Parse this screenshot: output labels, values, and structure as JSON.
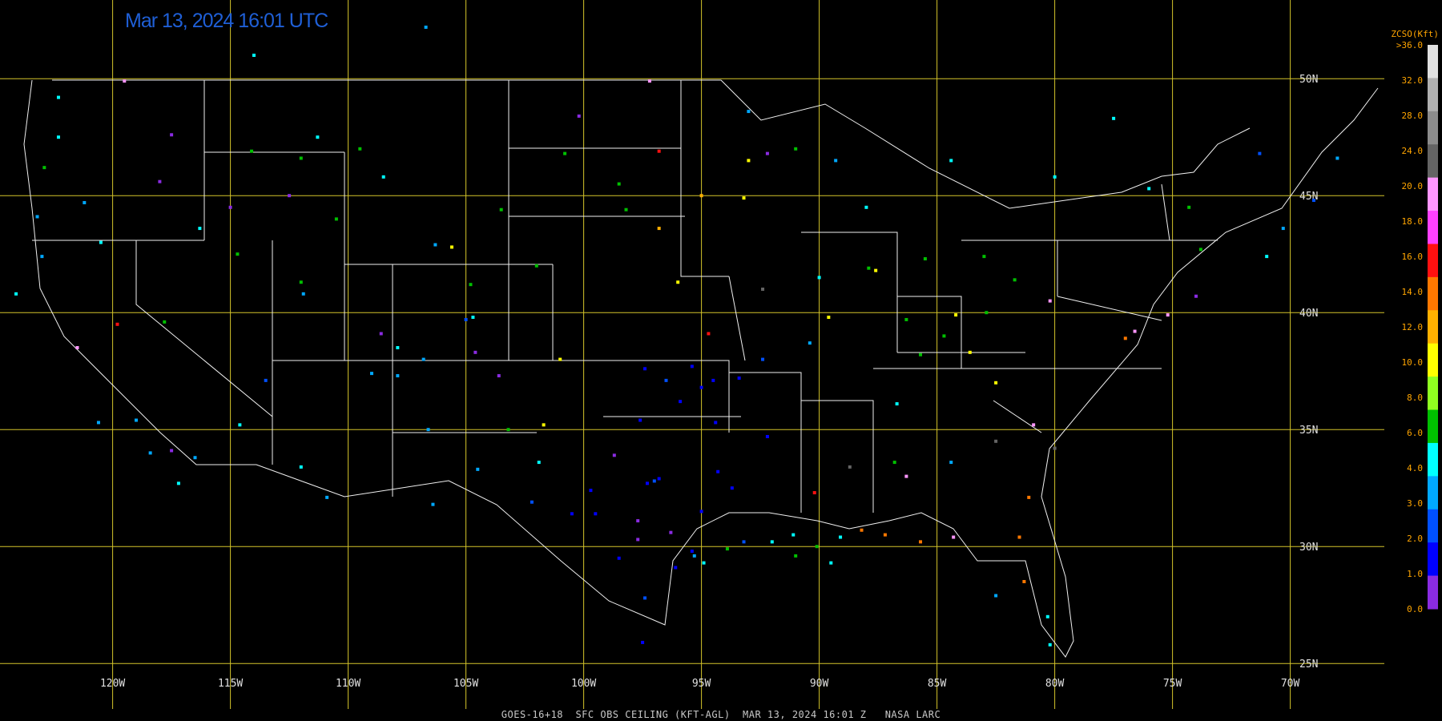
{
  "timestamp": "Mar 13, 2024 16:01 UTC",
  "footer": "GOES-16+18  SFC OBS CEILING (KFT-AGL)  MAR 13, 2024 16:01 Z   NASA LARC",
  "colorbar": {
    "title": "ZCSO(Kft)",
    "labels": [
      ">36.0",
      "32.0",
      "28.0",
      "24.0",
      "20.0",
      "18.0",
      "16.0",
      "14.0",
      "12.0",
      "10.0",
      "8.0",
      "6.0",
      "4.0",
      "3.0",
      "2.0",
      "1.0",
      "0.0"
    ],
    "colors": [
      "#e0e0e0",
      "#b0b0b0",
      "#8c8c8c",
      "#646464",
      "#ff96ff",
      "#ff40ff",
      "#ff1010",
      "#ff7800",
      "#ffb000",
      "#ffff00",
      "#90ff20",
      "#00c000",
      "#00ffff",
      "#00a8ff",
      "#0050ff",
      "#0000ff",
      "#8a2be2"
    ]
  },
  "grid": {
    "lon_labels": [
      "120W",
      "115W",
      "110W",
      "105W",
      "100W",
      "95W",
      "90W",
      "85W",
      "80W",
      "75W",
      "70W"
    ],
    "lat_labels": [
      "50N",
      "45N",
      "40N",
      "35N",
      "30N",
      "25N"
    ],
    "line_color": "#d4c42a"
  },
  "stations": [
    {
      "lon": -122.3,
      "lat": 47.5,
      "c": "#00ffff"
    },
    {
      "lon": -122.9,
      "lat": 46.2,
      "c": "#00c000"
    },
    {
      "lon": -123.2,
      "lat": 44.1,
      "c": "#00a8ff"
    },
    {
      "lon": -121.2,
      "lat": 44.7,
      "c": "#00a8ff"
    },
    {
      "lon": -117.5,
      "lat": 47.6,
      "c": "#8a2be2"
    },
    {
      "lon": -116.3,
      "lat": 43.6,
      "c": "#00ffff"
    },
    {
      "lon": -112.0,
      "lat": 46.6,
      "c": "#00c000"
    },
    {
      "lon": -108.5,
      "lat": 45.8,
      "c": "#00ffff"
    },
    {
      "lon": -106.3,
      "lat": 42.9,
      "c": "#00a8ff"
    },
    {
      "lon": -104.8,
      "lat": 41.2,
      "c": "#00c000"
    },
    {
      "lon": -104.7,
      "lat": 39.8,
      "c": "#00ffff"
    },
    {
      "lon": -105.0,
      "lat": 39.7,
      "c": "#0050ff"
    },
    {
      "lon": -107.9,
      "lat": 38.5,
      "c": "#00ffff"
    },
    {
      "lon": -108.6,
      "lat": 39.1,
      "c": "#8a2be2"
    },
    {
      "lon": -106.8,
      "lat": 38.0,
      "c": "#00a8ff"
    },
    {
      "lon": -111.9,
      "lat": 40.8,
      "c": "#00a8ff"
    },
    {
      "lon": -112.0,
      "lat": 41.3,
      "c": "#00c000"
    },
    {
      "lon": -114.7,
      "lat": 42.5,
      "c": "#00c000"
    },
    {
      "lon": -117.8,
      "lat": 39.6,
      "c": "#00c000"
    },
    {
      "lon": -119.8,
      "lat": 39.5,
      "c": "#ff1010"
    },
    {
      "lon": -121.5,
      "lat": 38.5,
      "c": "#ff96ff"
    },
    {
      "lon": -118.4,
      "lat": 34.0,
      "c": "#00a8ff"
    },
    {
      "lon": -117.2,
      "lat": 32.7,
      "c": "#00ffff"
    },
    {
      "lon": -117.5,
      "lat": 34.1,
      "c": "#8a2be2"
    },
    {
      "lon": -112.0,
      "lat": 33.4,
      "c": "#00ffff"
    },
    {
      "lon": -110.9,
      "lat": 32.1,
      "c": "#00a8ff"
    },
    {
      "lon": -106.6,
      "lat": 35.0,
      "c": "#00a8ff"
    },
    {
      "lon": -106.4,
      "lat": 31.8,
      "c": "#00a8ff"
    },
    {
      "lon": -104.5,
      "lat": 33.3,
      "c": "#00a8ff"
    },
    {
      "lon": -101.7,
      "lat": 35.2,
      "c": "#ffff00"
    },
    {
      "lon": -101.0,
      "lat": 38.0,
      "c": "#ffff00"
    },
    {
      "lon": -97.4,
      "lat": 37.6,
      "c": "#0000ff"
    },
    {
      "lon": -97.6,
      "lat": 35.4,
      "c": "#0000ff"
    },
    {
      "lon": -95.9,
      "lat": 36.2,
      "c": "#0000ff"
    },
    {
      "lon": -94.7,
      "lat": 39.1,
      "c": "#ff1010"
    },
    {
      "lon": -96.0,
      "lat": 41.3,
      "c": "#ffff00"
    },
    {
      "lon": -96.8,
      "lat": 43.6,
      "c": "#ffb000"
    },
    {
      "lon": -98.5,
      "lat": 45.5,
      "c": "#00c000"
    },
    {
      "lon": -100.8,
      "lat": 46.8,
      "c": "#00c000"
    },
    {
      "lon": -96.8,
      "lat": 46.9,
      "c": "#ff1010"
    },
    {
      "lon": -93.2,
      "lat": 44.9,
      "c": "#ffff00"
    },
    {
      "lon": -90.0,
      "lat": 41.5,
      "c": "#00ffff"
    },
    {
      "lon": -87.9,
      "lat": 41.9,
      "c": "#00c000"
    },
    {
      "lon": -85.5,
      "lat": 42.3,
      "c": "#00c000"
    },
    {
      "lon": -83.0,
      "lat": 42.4,
      "c": "#00c000"
    },
    {
      "lon": -81.7,
      "lat": 41.4,
      "c": "#00c000"
    },
    {
      "lon": -80.2,
      "lat": 40.5,
      "c": "#ff96ff"
    },
    {
      "lon": -77.0,
      "lat": 38.9,
      "c": "#ff7800"
    },
    {
      "lon": -76.6,
      "lat": 39.2,
      "c": "#ff96ff"
    },
    {
      "lon": -75.2,
      "lat": 39.9,
      "c": "#ff96ff"
    },
    {
      "lon": -74.0,
      "lat": 40.7,
      "c": "#8a2be2"
    },
    {
      "lon": -73.8,
      "lat": 42.7,
      "c": "#00c000"
    },
    {
      "lon": -71.0,
      "lat": 42.4,
      "c": "#00ffff"
    },
    {
      "lon": -70.3,
      "lat": 43.6,
      "c": "#00a8ff"
    },
    {
      "lon": -69.0,
      "lat": 44.8,
      "c": "#0050ff"
    },
    {
      "lon": -74.3,
      "lat": 44.5,
      "c": "#00c000"
    },
    {
      "lon": -80.0,
      "lat": 45.8,
      "c": "#00ffff"
    },
    {
      "lon": -84.4,
      "lat": 33.6,
      "c": "#00a8ff"
    },
    {
      "lon": -81.1,
      "lat": 32.1,
      "c": "#ff7800"
    },
    {
      "lon": -81.5,
      "lat": 30.4,
      "c": "#ff7800"
    },
    {
      "lon": -80.3,
      "lat": 27.0,
      "c": "#00ffff"
    },
    {
      "lon": -80.2,
      "lat": 25.8,
      "c": "#00ffff"
    },
    {
      "lon": -86.8,
      "lat": 33.6,
      "c": "#00c000"
    },
    {
      "lon": -87.2,
      "lat": 30.5,
      "c": "#ff7800"
    },
    {
      "lon": -88.2,
      "lat": 30.7,
      "c": "#ff7800"
    },
    {
      "lon": -89.1,
      "lat": 30.4,
      "c": "#00ffff"
    },
    {
      "lon": -90.1,
      "lat": 30.0,
      "c": "#00c000"
    },
    {
      "lon": -90.2,
      "lat": 32.3,
      "c": "#ff1010"
    },
    {
      "lon": -92.2,
      "lat": 34.7,
      "c": "#0000ff"
    },
    {
      "lon": -94.4,
      "lat": 35.3,
      "c": "#0000ff"
    },
    {
      "lon": -93.7,
      "lat": 32.5,
      "c": "#0000ff"
    },
    {
      "lon": -93.2,
      "lat": 30.2,
      "c": "#0050ff"
    },
    {
      "lon": -91.1,
      "lat": 30.5,
      "c": "#00ffff"
    },
    {
      "lon": -95.4,
      "lat": 29.8,
      "c": "#0000ff"
    },
    {
      "lon": -95.3,
      "lat": 29.6,
      "c": "#00a8ff"
    },
    {
      "lon": -94.9,
      "lat": 29.3,
      "c": "#00ffff"
    },
    {
      "lon": -96.8,
      "lat": 32.9,
      "c": "#0000ff"
    },
    {
      "lon": -97.0,
      "lat": 32.8,
      "c": "#0050ff"
    },
    {
      "lon": -97.3,
      "lat": 32.7,
      "c": "#0000ff"
    },
    {
      "lon": -98.5,
      "lat": 29.5,
      "c": "#0000ff"
    },
    {
      "lon": -97.7,
      "lat": 30.3,
      "c": "#8a2be2"
    },
    {
      "lon": -97.4,
      "lat": 27.8,
      "c": "#0050ff"
    },
    {
      "lon": -97.5,
      "lat": 25.9,
      "c": "#0000ff"
    },
    {
      "lon": -99.5,
      "lat": 31.4,
      "c": "#0000ff"
    },
    {
      "lon": -96.3,
      "lat": 30.6,
      "c": "#8a2be2"
    },
    {
      "lon": -95.0,
      "lat": 31.5,
      "c": "#0000ff"
    },
    {
      "lon": -94.3,
      "lat": 33.2,
      "c": "#0000ff"
    },
    {
      "lon": -100.5,
      "lat": 31.4,
      "c": "#0000ff"
    },
    {
      "lon": -95.4,
      "lat": 37.7,
      "c": "#0000ff"
    },
    {
      "lon": -96.5,
      "lat": 37.1,
      "c": "#0050ff"
    },
    {
      "lon": -95.0,
      "lat": 36.8,
      "c": "#0000ff"
    },
    {
      "lon": -94.5,
      "lat": 37.1,
      "c": "#0000ff"
    },
    {
      "lon": -93.4,
      "lat": 37.2,
      "c": "#0000ff"
    },
    {
      "lon": -92.4,
      "lat": 38.0,
      "c": "#0050ff"
    },
    {
      "lon": -90.4,
      "lat": 38.7,
      "c": "#00a8ff"
    },
    {
      "lon": -86.7,
      "lat": 36.1,
      "c": "#00ffff"
    },
    {
      "lon": -85.7,
      "lat": 38.2,
      "c": "#00c000"
    },
    {
      "lon": -84.7,
      "lat": 39.0,
      "c": "#00c000"
    },
    {
      "lon": -83.6,
      "lat": 38.3,
      "c": "#ffff00"
    },
    {
      "lon": -82.5,
      "lat": 37.0,
      "c": "#ffff00"
    },
    {
      "lon": -82.9,
      "lat": 40.0,
      "c": "#00c000"
    },
    {
      "lon": -84.2,
      "lat": 39.9,
      "c": "#ffff00"
    },
    {
      "lon": -80.9,
      "lat": 35.2,
      "c": "#ff96ff"
    },
    {
      "lon": -80.0,
      "lat": 34.2,
      "c": "#646464"
    },
    {
      "lon": -82.5,
      "lat": 34.5,
      "c": "#646464"
    },
    {
      "lon": -88.7,
      "lat": 33.4,
      "c": "#646464"
    },
    {
      "lon": -86.3,
      "lat": 33.0,
      "c": "#ff96ff"
    },
    {
      "lon": -92.4,
      "lat": 41.0,
      "c": "#646464"
    },
    {
      "lon": -105.6,
      "lat": 42.8,
      "c": "#ffff00"
    },
    {
      "lon": -102.0,
      "lat": 42.0,
      "c": "#00c000"
    },
    {
      "lon": -103.5,
      "lat": 44.4,
      "c": "#00c000"
    },
    {
      "lon": -98.2,
      "lat": 44.4,
      "c": "#00c000"
    },
    {
      "lon": -95.0,
      "lat": 45.0,
      "c": "#ffb000"
    },
    {
      "lon": -93.0,
      "lat": 46.5,
      "c": "#ffff00"
    },
    {
      "lon": -91.0,
      "lat": 47.0,
      "c": "#00c000"
    },
    {
      "lon": -92.2,
      "lat": 46.8,
      "c": "#8a2be2"
    },
    {
      "lon": -109.5,
      "lat": 47.0,
      "c": "#00c000"
    },
    {
      "lon": -111.3,
      "lat": 47.5,
      "c": "#00ffff"
    },
    {
      "lon": -114.1,
      "lat": 46.9,
      "c": "#00c000"
    },
    {
      "lon": -112.5,
      "lat": 45.0,
      "c": "#8a2be2"
    },
    {
      "lon": -110.5,
      "lat": 44.0,
      "c": "#00c000"
    },
    {
      "lon": -115.0,
      "lat": 44.5,
      "c": "#8a2be2"
    },
    {
      "lon": -118.0,
      "lat": 45.6,
      "c": "#8a2be2"
    },
    {
      "lon": -120.5,
      "lat": 43.0,
      "c": "#00ffff"
    },
    {
      "lon": -123.0,
      "lat": 42.4,
      "c": "#00a8ff"
    },
    {
      "lon": -124.1,
      "lat": 40.8,
      "c": "#00ffff"
    },
    {
      "lon": -119.0,
      "lat": 35.4,
      "c": "#00a8ff"
    },
    {
      "lon": -120.6,
      "lat": 35.3,
      "c": "#00a8ff"
    },
    {
      "lon": -116.5,
      "lat": 33.8,
      "c": "#00a8ff"
    },
    {
      "lon": -114.6,
      "lat": 35.2,
      "c": "#00ffff"
    },
    {
      "lon": -113.5,
      "lat": 37.1,
      "c": "#0050ff"
    },
    {
      "lon": -109.0,
      "lat": 37.4,
      "c": "#00a8ff"
    },
    {
      "lon": -107.9,
      "lat": 37.3,
      "c": "#00a8ff"
    },
    {
      "lon": -104.6,
      "lat": 38.3,
      "c": "#8a2be2"
    },
    {
      "lon": -103.6,
      "lat": 37.3,
      "c": "#8a2be2"
    },
    {
      "lon": -103.2,
      "lat": 35.0,
      "c": "#00c000"
    },
    {
      "lon": -101.9,
      "lat": 33.6,
      "c": "#00ffff"
    },
    {
      "lon": -102.2,
      "lat": 31.9,
      "c": "#0050ff"
    },
    {
      "lon": -99.7,
      "lat": 32.4,
      "c": "#0000ff"
    },
    {
      "lon": -98.7,
      "lat": 33.9,
      "c": "#8a2be2"
    },
    {
      "lon": -97.7,
      "lat": 31.1,
      "c": "#8a2be2"
    },
    {
      "lon": -96.1,
      "lat": 29.1,
      "c": "#0000ff"
    },
    {
      "lon": -93.9,
      "lat": 29.9,
      "c": "#00c000"
    },
    {
      "lon": -92.0,
      "lat": 30.2,
      "c": "#00ffff"
    },
    {
      "lon": -91.0,
      "lat": 29.6,
      "c": "#00c000"
    },
    {
      "lon": -89.5,
      "lat": 29.3,
      "c": "#00ffff"
    },
    {
      "lon": -85.7,
      "lat": 30.2,
      "c": "#ff7800"
    },
    {
      "lon": -84.3,
      "lat": 30.4,
      "c": "#ff96ff"
    },
    {
      "lon": -82.5,
      "lat": 27.9,
      "c": "#00a8ff"
    },
    {
      "lon": -81.3,
      "lat": 28.5,
      "c": "#ff7800"
    },
    {
      "lon": -87.6,
      "lat": 41.8,
      "c": "#ffff00"
    },
    {
      "lon": -86.3,
      "lat": 39.7,
      "c": "#00c000"
    },
    {
      "lon": -89.6,
      "lat": 39.8,
      "c": "#ffff00"
    },
    {
      "lon": -88.0,
      "lat": 44.5,
      "c": "#00ffff"
    },
    {
      "lon": -89.3,
      "lat": 46.5,
      "c": "#00a8ff"
    },
    {
      "lon": -84.4,
      "lat": 46.5,
      "c": "#00ffff"
    },
    {
      "lon": -77.5,
      "lat": 48.3,
      "c": "#00ffff"
    },
    {
      "lon": -76.0,
      "lat": 45.3,
      "c": "#00ffff"
    },
    {
      "lon": -71.3,
      "lat": 46.8,
      "c": "#0050ff"
    },
    {
      "lon": -68.0,
      "lat": 46.6,
      "c": "#00a8ff"
    },
    {
      "lon": -122.3,
      "lat": 49.2,
      "c": "#00ffff"
    },
    {
      "lon": -119.5,
      "lat": 49.9,
      "c": "#ff96ff"
    },
    {
      "lon": -114.0,
      "lat": 51.0,
      "c": "#00ffff"
    },
    {
      "lon": -106.7,
      "lat": 52.2,
      "c": "#00a8ff"
    },
    {
      "lon": -97.2,
      "lat": 49.9,
      "c": "#ff96ff"
    },
    {
      "lon": -93.0,
      "lat": 48.6,
      "c": "#00a8ff"
    },
    {
      "lon": -100.2,
      "lat": 48.4,
      "c": "#8a2be2"
    }
  ]
}
